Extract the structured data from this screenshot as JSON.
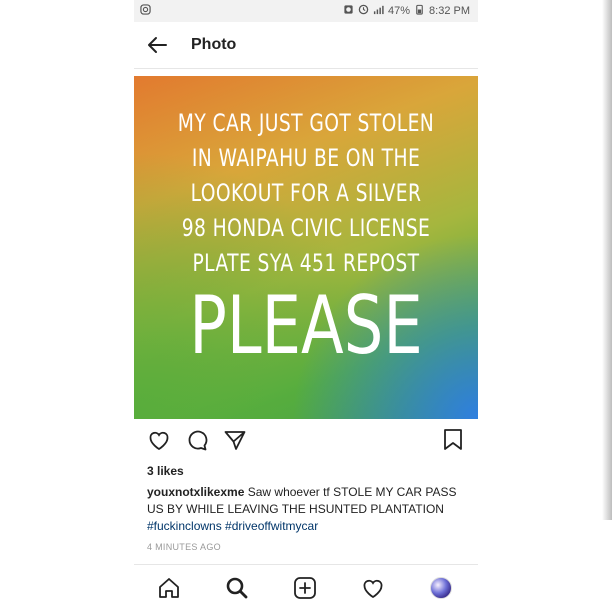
{
  "status_bar": {
    "battery": "47%",
    "time": "8:32 PM",
    "icons": [
      "instagram-notification-icon",
      "alarm-icon",
      "vibrate-icon",
      "signal-icon",
      "battery-icon"
    ]
  },
  "header": {
    "title": "Photo",
    "back_icon": "back-arrow-icon"
  },
  "photo": {
    "lines": [
      "MY CAR JUST GOT STOLEN",
      "IN WAIPAHU BE ON THE",
      "LOOKOUT FOR A SILVER",
      "98 HONDA CIVIC LICENSE",
      "PLATE SYA 451 REPOST"
    ],
    "big_word": "PLEASE"
  },
  "actions": {
    "icons": [
      "heart-icon",
      "comment-icon",
      "share-icon",
      "bookmark-icon"
    ]
  },
  "post": {
    "likes": "3 likes",
    "username": "youxnotxlikexme",
    "caption": "Saw whoever tf STOLE MY CAR PASS US BY WHILE LEAVING THE HSUNTED PLANTATION",
    "hashtags": [
      "#fuckinclowns",
      "#driveoffwitmycar"
    ],
    "timestamp": "4 MINUTES AGO"
  },
  "bottom_nav": {
    "icons": [
      "home-icon",
      "search-icon",
      "add-post-icon",
      "activity-heart-icon",
      "profile-avatar"
    ]
  }
}
